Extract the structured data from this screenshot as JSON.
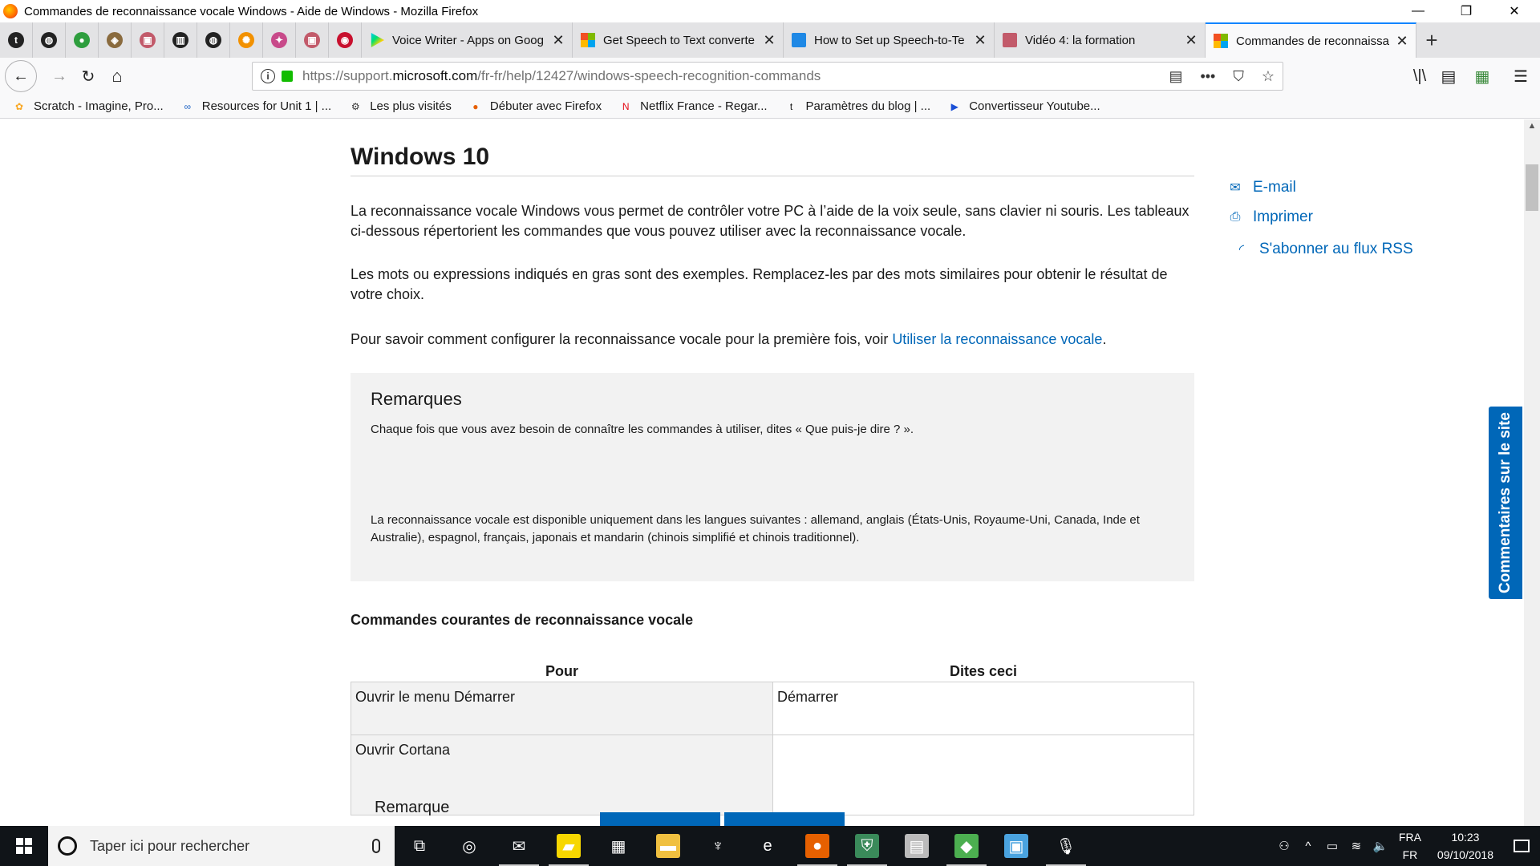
{
  "window": {
    "title": "Commandes de reconnaissance vocale Windows - Aide de Windows - Mozilla Firefox",
    "controls": {
      "minimize": "—",
      "maximize": "❐",
      "close": "✕"
    }
  },
  "tabs": {
    "pinned": [
      {
        "icon": "tumblr-icon",
        "glyph": "t",
        "color": "#222222"
      },
      {
        "icon": "globe-icon",
        "glyph": "◍",
        "color": "#222222"
      },
      {
        "icon": "green-app-icon",
        "glyph": "●",
        "color": "#2e9e3e"
      },
      {
        "icon": "badge-icon",
        "glyph": "◈",
        "color": "#8a6b3e"
      },
      {
        "icon": "image-icon",
        "glyph": "▣",
        "color": "#c25a6a"
      },
      {
        "icon": "chart-icon",
        "glyph": "▥",
        "color": "#222222"
      },
      {
        "icon": "globe-icon",
        "glyph": "◍",
        "color": "#222222"
      },
      {
        "icon": "orange-app-icon",
        "glyph": "✺",
        "color": "#f29100"
      },
      {
        "icon": "puzzle-icon",
        "glyph": "✦",
        "color": "#c84a8a"
      },
      {
        "icon": "image-icon",
        "glyph": "▣",
        "color": "#c25a6a"
      },
      {
        "icon": "red-circle-icon",
        "glyph": "◉",
        "color": "#c8102e"
      }
    ],
    "open": [
      {
        "label": "Voice Writer - Apps on Goog",
        "icon": "google-play-icon",
        "color": "#00b060",
        "active": false
      },
      {
        "label": "Get Speech to Text converte",
        "icon": "microsoft-logo-icon",
        "color": "#f25022",
        "active": false
      },
      {
        "label": "How to Set up Speech-to-Te",
        "icon": "plus-icon",
        "color": "#1e88e5",
        "active": false
      },
      {
        "label": "Vidéo 4: la formation",
        "icon": "image-icon",
        "color": "#c25a6a",
        "active": false
      },
      {
        "label": "Commandes de reconnaissa",
        "icon": "microsoft-logo-icon",
        "color": "#f25022",
        "active": true
      }
    ],
    "close_glyph": "✕",
    "new_tab_glyph": "+"
  },
  "nav": {
    "back": "←",
    "forward": "→",
    "reload": "↻",
    "home": "⌂",
    "url_prefix": "https://support.",
    "url_domain": "microsoft.com",
    "url_path": "/fr-fr/help/12427/windows-speech-recognition-commands",
    "page_actions": "•••",
    "tools": {
      "library": "\\|\\",
      "sidebar": "▤",
      "menu": "☰"
    }
  },
  "bookmarks": [
    {
      "label": "Scratch - Imagine, Pro...",
      "icon": "scratch-icon",
      "glyph": "✿",
      "color": "#f9a825"
    },
    {
      "label": "Resources for Unit 1 | ...",
      "icon": "infinity-icon",
      "glyph": "∞",
      "color": "#1e63c4"
    },
    {
      "label": "Les plus visités",
      "icon": "gear-icon",
      "glyph": "⚙",
      "color": "#333333"
    },
    {
      "label": "Débuter avec Firefox",
      "icon": "firefox-icon",
      "glyph": "●",
      "color": "#e66000"
    },
    {
      "label": "Netflix France - Regar...",
      "icon": "netflix-icon",
      "glyph": "N",
      "color": "#e50914"
    },
    {
      "label": "Paramètres du blog | ...",
      "icon": "tumblr-icon",
      "glyph": "t",
      "color": "#111111"
    },
    {
      "label": "Convertisseur Youtube...",
      "icon": "video-icon",
      "glyph": "▶",
      "color": "#1a4fd6"
    }
  ],
  "page": {
    "heading": "Windows 10",
    "p1": "La reconnaissance vocale Windows vous permet de contrôler votre PC à l’aide de la voix seule, sans clavier ni souris. Les tableaux ci-dessous répertorient les commandes que vous pouvez utiliser avec la reconnaissance vocale.",
    "p2": "Les mots ou expressions indiqués en gras sont des exemples. Remplacez-les par des mots similaires pour obtenir le résultat de votre choix.",
    "p3_text": "Pour savoir comment configurer la reconnaissance vocale pour la première fois, voir ",
    "p3_link": "Utiliser la reconnaissance vocale",
    "p3_end": ".",
    "aside": {
      "email": "E-mail",
      "print": "Imprimer",
      "rss": "S'abonner au flux RSS"
    },
    "notes": {
      "title": "Remarques",
      "n1": "Chaque fois que vous avez besoin de connaître les commandes à utiliser, dites « Que puis-je dire ? ».",
      "n2": "La reconnaissance vocale est disponible uniquement dans les langues suivantes : allemand, anglais (États-Unis, Royaume-Uni, Canada, Inde et Australie), espagnol, français, japonais et mandarin (chinois simplifié et chinois traditionnel)."
    },
    "section_title": "Commandes courantes de reconnaissance vocale",
    "table": {
      "headers": [
        "Pour",
        "Dites ceci"
      ],
      "rows": [
        [
          "Ouvrir le menu Démarrer",
          "Démarrer"
        ],
        [
          "Ouvrir Cortana",
          ""
        ]
      ]
    },
    "peek_heading": "Remarque",
    "feedback": "Commentaires sur le site"
  },
  "taskbar": {
    "search_placeholder": "Taper ici pour rechercher",
    "apps": [
      {
        "icon": "task-view-icon",
        "glyph": "⧉",
        "color": "transparent",
        "running": false
      },
      {
        "icon": "cortana-ring-icon",
        "glyph": "◎",
        "color": "transparent",
        "running": false
      },
      {
        "icon": "mail-icon",
        "glyph": "✉",
        "color": "transparent",
        "running": true
      },
      {
        "icon": "sticky-notes-icon",
        "glyph": "▰",
        "color": "#f7d700",
        "running": true
      },
      {
        "icon": "store-icon",
        "glyph": "▦",
        "color": "transparent",
        "running": false
      },
      {
        "icon": "file-explorer-icon",
        "glyph": "▬",
        "color": "#f0c040",
        "running": false
      },
      {
        "icon": "predator-icon",
        "glyph": "♆",
        "color": "transparent",
        "running": false
      },
      {
        "icon": "edge-icon",
        "glyph": "e",
        "color": "transparent",
        "running": false
      },
      {
        "icon": "firefox-icon",
        "glyph": "●",
        "color": "#e66000",
        "running": true
      },
      {
        "icon": "shield-app-icon",
        "glyph": "⛨",
        "color": "#3a8a5a",
        "running": true
      },
      {
        "icon": "printer-app-icon",
        "glyph": "▤",
        "color": "#bbbbbb",
        "running": false
      },
      {
        "icon": "sims-icon",
        "glyph": "◆",
        "color": "#4caf50",
        "running": true
      },
      {
        "icon": "control-panel-icon",
        "glyph": "▣",
        "color": "#4aa3df",
        "running": false
      },
      {
        "icon": "microphone-icon",
        "glyph": "🎙",
        "color": "transparent",
        "running": true
      }
    ],
    "tray": {
      "people": "⚇",
      "chevron": "^",
      "battery": "▭",
      "wifi": "≋",
      "volume": "🔈",
      "lang_top": "FRA",
      "lang_bottom": "FR",
      "time": "10:23",
      "date": "09/10/2018"
    }
  }
}
